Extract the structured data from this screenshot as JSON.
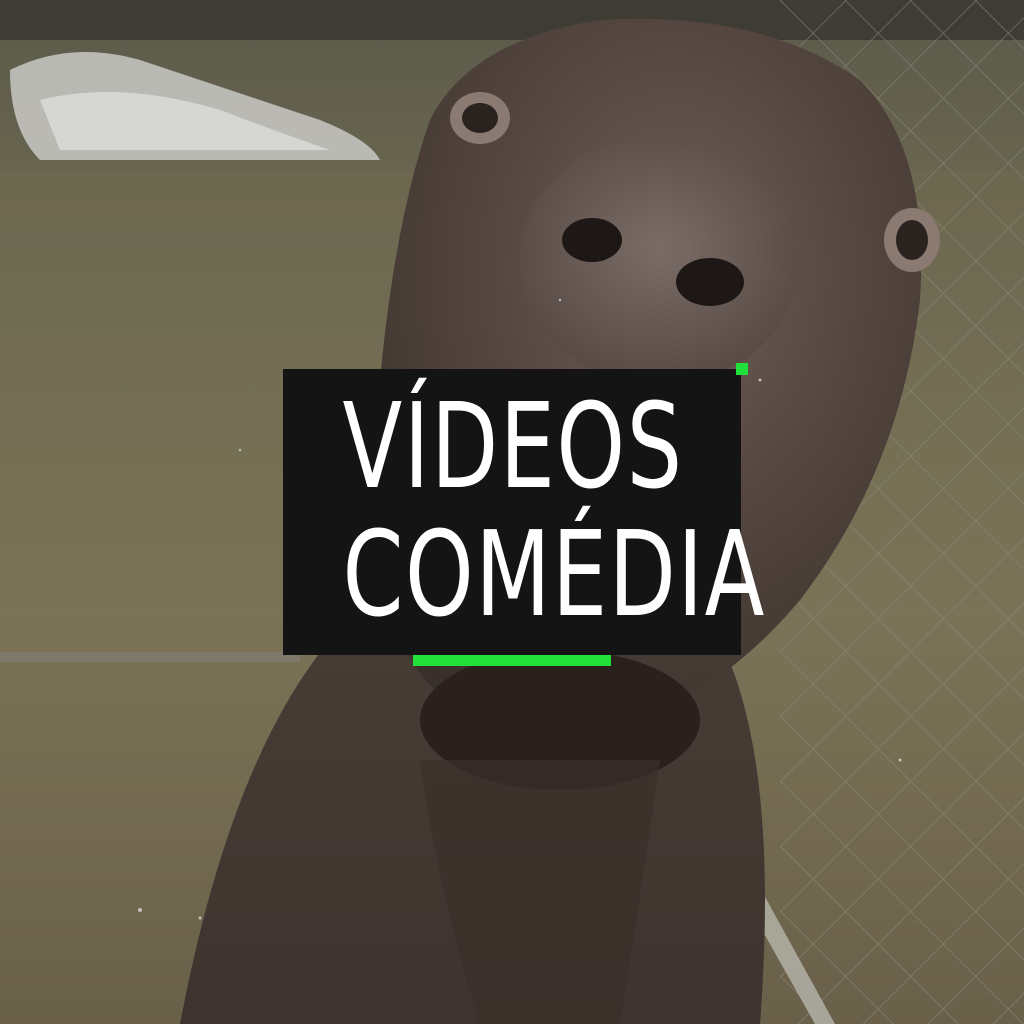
{
  "title": {
    "line1": "VÍDEOS",
    "line2": "COMÉDIA"
  },
  "colors": {
    "accent": "#22e03a",
    "title_box": "#141414",
    "title_text": "#ffffff"
  },
  "image": {
    "subject": "goat-face-closeup"
  }
}
